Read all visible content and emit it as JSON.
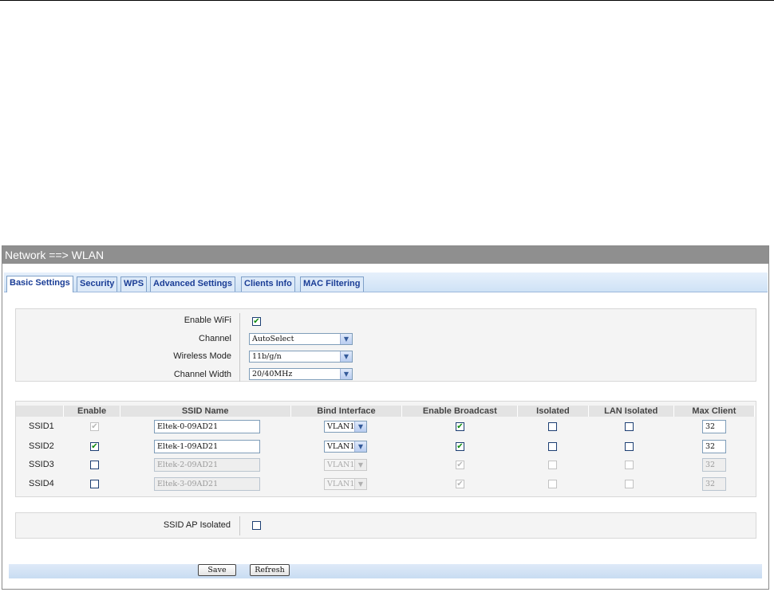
{
  "header": {
    "title": "Network ==> WLAN"
  },
  "tabs": [
    {
      "label": "Basic Settings",
      "active": true
    },
    {
      "label": "Security"
    },
    {
      "label": "WPS"
    },
    {
      "label": "Advanced Settings"
    },
    {
      "label": "Clients Info"
    },
    {
      "label": "MAC Filtering"
    }
  ],
  "basic": {
    "enable_wifi_label": "Enable WiFi",
    "enable_wifi_checked": true,
    "channel_label": "Channel",
    "channel_value": "AutoSelect",
    "wireless_mode_label": "Wireless Mode",
    "wireless_mode_value": "11b/g/n",
    "channel_width_label": "Channel Width",
    "channel_width_value": "20/40MHz"
  },
  "ssid_table": {
    "columns": [
      "",
      "Enable",
      "SSID Name",
      "Bind Interface",
      "Enable Broadcast",
      "Isolated",
      "LAN Isolated",
      "Max Client"
    ],
    "rows": [
      {
        "label": "SSID1",
        "enable": true,
        "enable_disabled": true,
        "name": "Eltek-0-09AD21",
        "interface": "VLAN1",
        "broadcast": true,
        "isolated": false,
        "lan_isolated": false,
        "max_client": "32",
        "disabled": false
      },
      {
        "label": "SSID2",
        "enable": true,
        "enable_disabled": false,
        "name": "Eltek-1-09AD21",
        "interface": "VLAN1",
        "broadcast": true,
        "isolated": false,
        "lan_isolated": false,
        "max_client": "32",
        "disabled": false
      },
      {
        "label": "SSID3",
        "enable": false,
        "enable_disabled": false,
        "name": "Eltek-2-09AD21",
        "interface": "VLAN1",
        "broadcast": true,
        "isolated": false,
        "lan_isolated": false,
        "max_client": "32",
        "disabled": true
      },
      {
        "label": "SSID4",
        "enable": false,
        "enable_disabled": false,
        "name": "Eltek-3-09AD21",
        "interface": "VLAN1",
        "broadcast": true,
        "isolated": false,
        "lan_isolated": false,
        "max_client": "32",
        "disabled": true
      }
    ]
  },
  "ap_isolated": {
    "label": "SSID AP Isolated",
    "checked": false
  },
  "buttons": {
    "save": "Save",
    "refresh": "Refresh"
  },
  "colors": {
    "tab_text": "#1a3d96",
    "title_bar": "#8f8f8f",
    "check_mark": "#0b8a0b"
  }
}
